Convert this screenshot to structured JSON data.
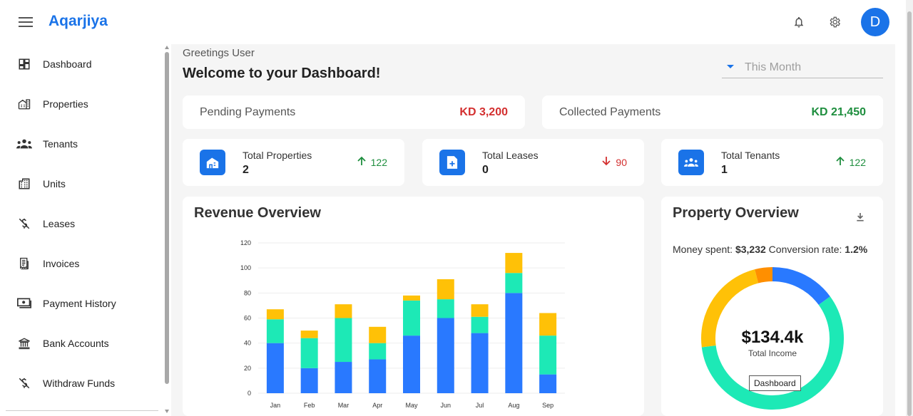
{
  "header": {
    "brand": "Aqarjiya",
    "avatar_letter": "D",
    "icons": [
      "menu-icon",
      "bell-icon",
      "gear-icon"
    ]
  },
  "sidebar": {
    "items": [
      {
        "label": "Dashboard",
        "icon": "dashboard-icon"
      },
      {
        "label": "Properties",
        "icon": "buildings-icon"
      },
      {
        "label": "Tenants",
        "icon": "people-icon"
      },
      {
        "label": "Units",
        "icon": "apartment-icon"
      },
      {
        "label": "Leases",
        "icon": "money-off-icon"
      },
      {
        "label": "Invoices",
        "icon": "receipt-icon"
      },
      {
        "label": "Payment History",
        "icon": "cash-icon"
      },
      {
        "label": "Bank Accounts",
        "icon": "bank-icon"
      },
      {
        "label": "Withdraw Funds",
        "icon": "money-off-icon"
      }
    ]
  },
  "main": {
    "greeting": "Greetings User",
    "welcome": "Welcome to your Dashboard!",
    "period": "This Month",
    "payments": {
      "pending": {
        "label": "Pending Payments",
        "value": "KD 3,200",
        "color": "#d32f2f"
      },
      "collected": {
        "label": "Collected Payments",
        "value": "KD 21,450",
        "color": "#1e8e3e"
      }
    },
    "stats": [
      {
        "label": "Total Properties",
        "value": "2",
        "trend": "122",
        "direction": "up",
        "icon": "home-icon"
      },
      {
        "label": "Total Leases",
        "value": "0",
        "trend": "90",
        "direction": "down",
        "icon": "document-add-icon"
      },
      {
        "label": "Total Tenants",
        "value": "1",
        "trend": "122",
        "direction": "up",
        "icon": "people-icon"
      }
    ],
    "trend_colors": {
      "up": "#1e8e3e",
      "down": "#d32f2f"
    },
    "revenue": {
      "title": "Revenue Overview"
    },
    "property": {
      "title": "Property Overview",
      "money_spent_label": "Money spent:",
      "money_spent": "$3,232",
      "conversion_label": "Conversion rate:",
      "conversion": "1.2%",
      "center_value": "$134.4k",
      "center_label": "Total Income",
      "tooltip": "Dashboard"
    }
  },
  "chart_data": [
    {
      "type": "bar",
      "stacked": true,
      "title": "Revenue Overview",
      "categories": [
        "Jan",
        "Feb",
        "Mar",
        "Apr",
        "May",
        "Jun",
        "Jul",
        "Aug",
        "Sep"
      ],
      "series": [
        {
          "color": "#2979ff",
          "values": [
            40,
            20,
            25,
            27,
            46,
            60,
            48,
            80,
            15
          ]
        },
        {
          "color": "#1de9b6",
          "values": [
            19,
            24,
            35,
            13,
            28,
            15,
            13,
            16,
            31
          ]
        },
        {
          "color": "#ffc107",
          "values": [
            8,
            6,
            11,
            13,
            4,
            16,
            10,
            16,
            18
          ]
        }
      ],
      "ylim": [
        0,
        120
      ],
      "yticks": [
        0,
        20,
        40,
        60,
        80,
        100,
        120
      ],
      "grid": true
    },
    {
      "type": "pie",
      "donut": true,
      "title": "Property Overview",
      "slices": [
        {
          "color": "#2979ff",
          "value": 15
        },
        {
          "color": "#1de9b6",
          "value": 58
        },
        {
          "color": "#ffc107",
          "value": 23
        },
        {
          "color": "#ff8f00",
          "value": 4
        }
      ]
    }
  ]
}
